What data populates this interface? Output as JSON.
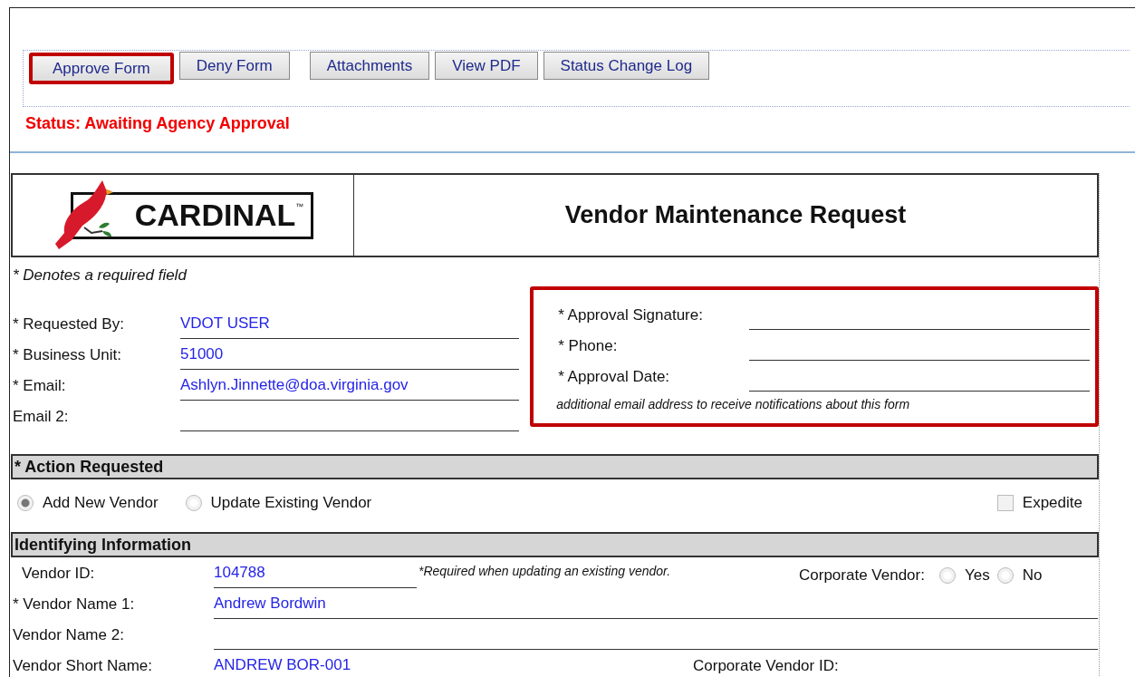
{
  "toolbar": {
    "buttons": [
      {
        "label": "Approve Form",
        "highlighted": true
      },
      {
        "label": "Deny Form",
        "highlighted": false
      },
      {
        "label": "Attachments",
        "highlighted": false
      },
      {
        "label": "View PDF",
        "highlighted": false
      },
      {
        "label": "Status Change Log",
        "highlighted": false
      }
    ]
  },
  "status": "Status: Awaiting Agency Approval",
  "header": {
    "logo": "CARDINAL",
    "logo_mark": "™",
    "title": "Vendor Maintenance Request"
  },
  "required_note": "* Denotes a required field",
  "requester_fields": [
    {
      "label": "* Requested By:",
      "value": "VDOT USER"
    },
    {
      "label": "* Business Unit:",
      "value": "51000"
    },
    {
      "label": "* Email:",
      "value": "Ashlyn.Jinnette@doa.virginia.gov"
    },
    {
      "label": "Email 2:"
    }
  ],
  "approval_panel": {
    "highlighted": true,
    "fields": [
      {
        "label": "* Approval Signature:"
      },
      {
        "label": "* Phone:"
      },
      {
        "label": "* Approval Date:"
      }
    ],
    "note": "additional email address to receive notifications about this form"
  },
  "action_requested": {
    "title": "* Action Requested",
    "options": [
      {
        "label": "Add New Vendor",
        "selected": true
      },
      {
        "label": "Update Existing Vendor",
        "selected": false
      }
    ],
    "expedite": {
      "label": "Expedite",
      "checked": false
    }
  },
  "identifying": {
    "title": "Identifying Information",
    "vendor_id": {
      "label": "Vendor ID:",
      "value": "104788",
      "note": "*Required when updating an existing vendor."
    },
    "corporate_vendor": {
      "label": "Corporate Vendor:",
      "options": [
        {
          "label": "Yes",
          "selected": false
        },
        {
          "label": "No",
          "selected": false
        }
      ]
    },
    "names": [
      {
        "label": "* Vendor Name 1:",
        "value": "Andrew Bordwin"
      },
      {
        "label": "Vendor Name 2:"
      }
    ],
    "short_name": {
      "label": "Vendor Short Name:",
      "value": "ANDREW BOR-001"
    },
    "corporate_vendor_id": {
      "label": "Corporate Vendor ID:"
    }
  }
}
